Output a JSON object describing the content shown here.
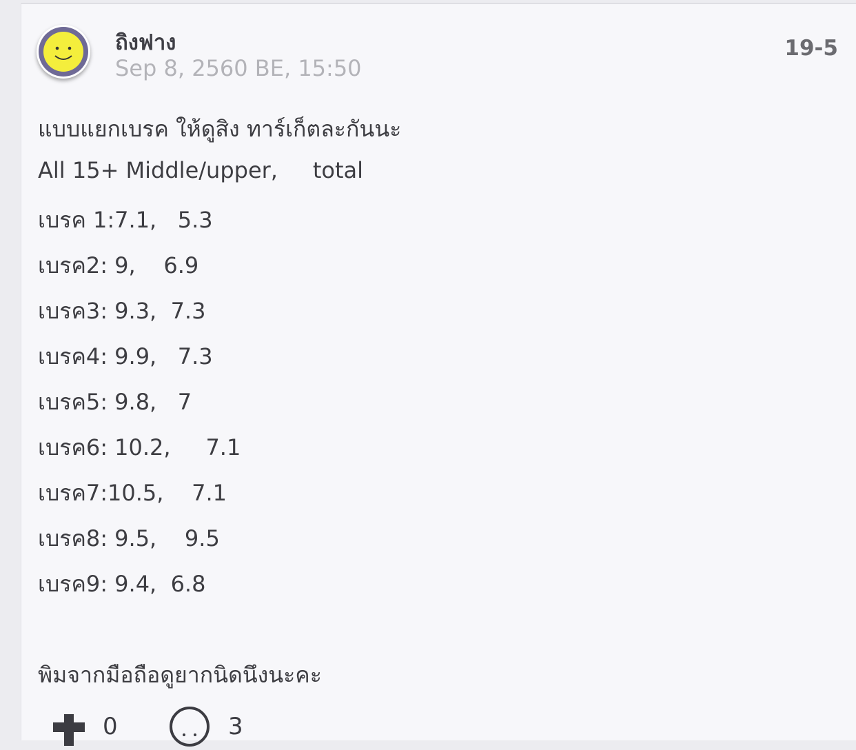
{
  "post": {
    "username": "ถิงฟาง",
    "timestamp": "Sep 8, 2560 BE, 15:50",
    "post_number": "19-5",
    "lines": [
      "แบบแยกเบรค ให้ดูสิง ทาร์เก็ตละกันนะ",
      "All 15+ Middle/upper,     total",
      "เบรค 1:7.1,   5.3",
      "เบรค2: 9,    6.9",
      "เบรค3: 9.3,  7.3",
      "เบรค4: 9.9,   7.3",
      "เบรค5: 9.8,   7",
      "เบรค6: 10.2,     7.1",
      "เบรค7:10.5,    7.1",
      "เบรค8: 9.5,    9.5",
      "เบรค9: 9.4,  6.8",
      "พิมจากมือถือดูยากนิดนึงนะคะ"
    ],
    "like_count": "0",
    "comment_count": "3"
  },
  "icons": {
    "avatar": "smiley-face-icon",
    "like": "plus-icon",
    "comment": "comment-bubble-icon"
  },
  "colors": {
    "avatar_face": "#f4ee3c",
    "avatar_ring": "#6f6a96"
  }
}
